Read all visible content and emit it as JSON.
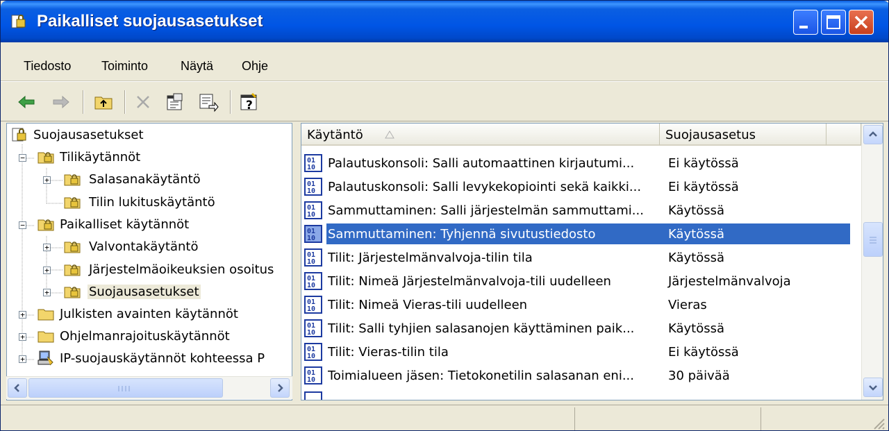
{
  "window": {
    "title": "Paikalliset suojausasetukset",
    "title_bar_color": "#0055e5",
    "controls": [
      "minimize-icon",
      "maximize-icon",
      "close-icon"
    ]
  },
  "menu": {
    "items": [
      "Tiedosto",
      "Toiminto",
      "Näytä",
      "Ohje"
    ]
  },
  "toolbar": {
    "tools": [
      "back-arrow-icon",
      "forward-arrow-icon",
      "up-folder-icon",
      "delete-icon",
      "properties-icon",
      "export-list-icon",
      "help-icon"
    ]
  },
  "tree": {
    "items": [
      {
        "label": "Suojausasetukset",
        "icon": "security-settings-icon"
      },
      {
        "label": "Tilikäytännöt",
        "icon": "policy-folder-icon"
      },
      {
        "label": "Salasanakäytäntö",
        "icon": "policy-folder-icon"
      },
      {
        "label": "Tilin lukituskäytäntö",
        "icon": "policy-folder-icon"
      },
      {
        "label": "Paikalliset käytännöt",
        "icon": "policy-folder-icon"
      },
      {
        "label": "Valvontakäytäntö",
        "icon": "policy-folder-icon"
      },
      {
        "label": "Järjestelmäoikeuksien osoitus",
        "icon": "policy-folder-icon"
      },
      {
        "label": "Suojausasetukset",
        "icon": "policy-folder-icon"
      },
      {
        "label": "Julkisten avainten käytännöt",
        "icon": "folder-icon"
      },
      {
        "label": "Ohjelmanrajoituskäytännöt",
        "icon": "folder-icon"
      },
      {
        "label": "IP-suojauskäytännöt kohteessa P",
        "icon": "ip-security-icon"
      }
    ],
    "selected": "Suojausasetukset"
  },
  "list": {
    "columns": {
      "policy": "Käytäntö",
      "setting": "Suojausasetus"
    },
    "rows": [
      {
        "policy": "Palautuskonsoli: Salli automaattinen kirjautumi...",
        "setting": "Ei käytössä"
      },
      {
        "policy": "Palautuskonsoli: Salli levykekopiointi sekä kaikki...",
        "setting": "Ei käytössä"
      },
      {
        "policy": "Sammuttaminen: Salli järjestelmän sammuttami...",
        "setting": "Käytössä"
      },
      {
        "policy": "Sammuttaminen: Tyhjennä sivutustiedosto",
        "setting": "Käytössä"
      },
      {
        "policy": "Tilit: Järjestelmänvalvoja-tilin tila",
        "setting": "Käytössä"
      },
      {
        "policy": "Tilit: Nimeä Järjestelmänvalvoja-tili uudelleen",
        "setting": "Järjestelmänvalvoja"
      },
      {
        "policy": "Tilit: Nimeä Vieras-tili uudelleen",
        "setting": "Vieras"
      },
      {
        "policy": "Tilit: Salli tyhjien salasanojen käyttäminen paik...",
        "setting": "Käytössä"
      },
      {
        "policy": "Tilit: Vieras-tilin tila",
        "setting": "Ei käytössä"
      },
      {
        "policy": "Toimialueen jäsen: Tietokonetilin salasanan eni...",
        "setting": "30 päivää"
      }
    ],
    "selected_row": "Sammuttaminen: Tyhjennä sivutustiedosto",
    "selection_color": "#316ac5"
  }
}
